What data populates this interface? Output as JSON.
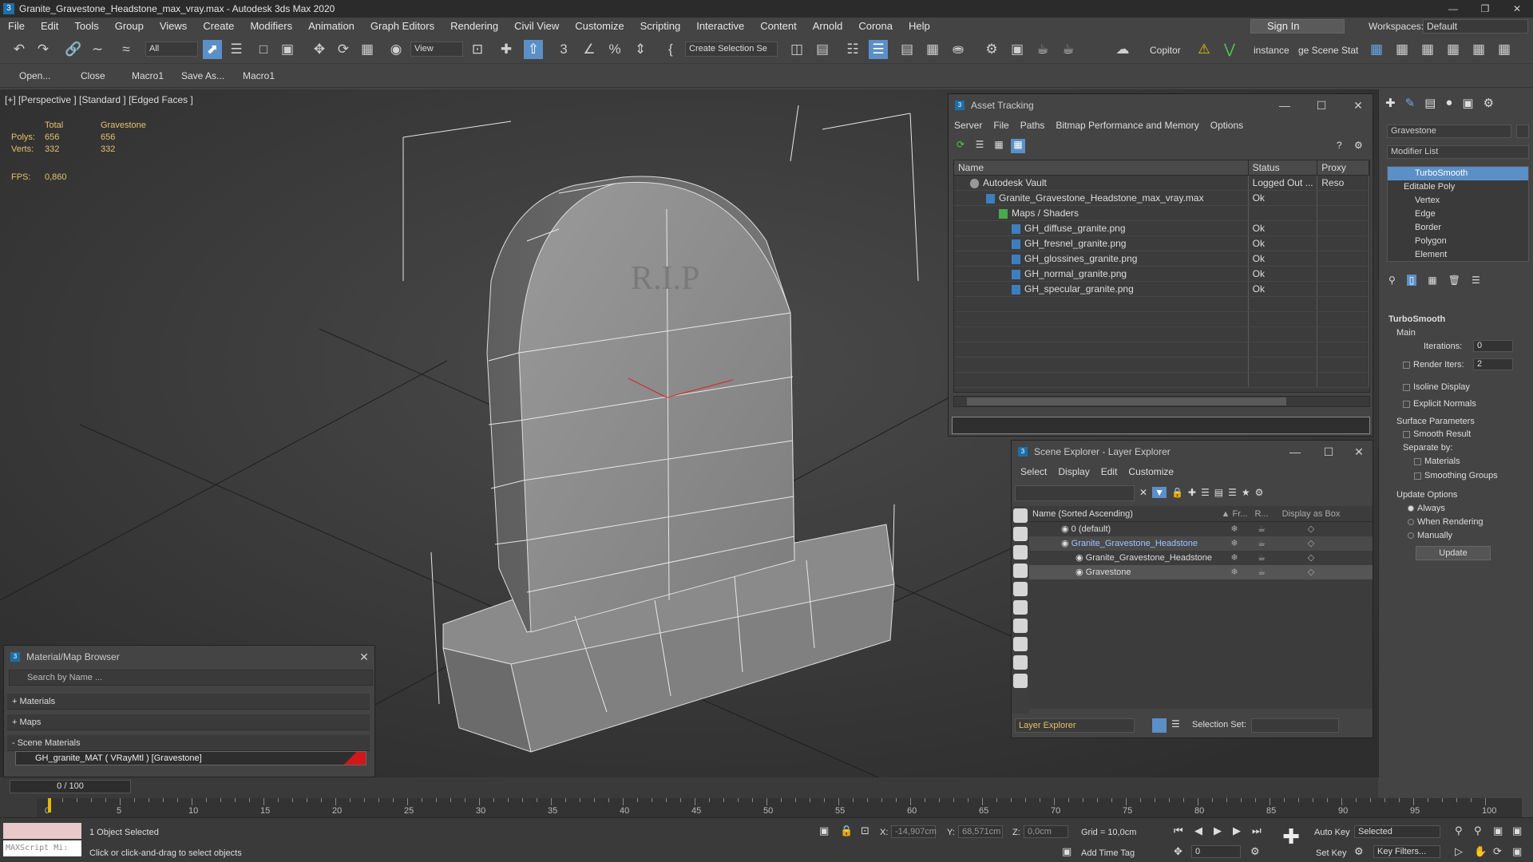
{
  "window": {
    "title": "Granite_Gravestone_Headstone_max_vray.max - Autodesk 3ds Max 2020",
    "app_icon": "3"
  },
  "menu": [
    "File",
    "Edit",
    "Tools",
    "Group",
    "Views",
    "Create",
    "Modifiers",
    "Animation",
    "Graph Editors",
    "Rendering",
    "Civil View",
    "Customize",
    "Scripting",
    "Interactive",
    "Content",
    "Arnold",
    "Corona",
    "Help"
  ],
  "account": {
    "sign_in": "Sign In",
    "workspaces_label": "Workspaces:",
    "workspace": "Default"
  },
  "toolbar": {
    "filter": "All",
    "view": "View",
    "selection_set": "Create Selection Se",
    "copitor": "Copitor",
    "instance": "instance",
    "scene_state": "ge Scene Stat"
  },
  "macrobar": [
    "Open...",
    "Close",
    "Macro1",
    "Save As...",
    "Macro1"
  ],
  "viewport": {
    "label": "[+] [Perspective ] [Standard ] [Edged Faces ]",
    "stats": {
      "h1": "Total",
      "h2": "Gravestone",
      "polys_label": "Polys:",
      "polys_total": "656",
      "polys_obj": "656",
      "verts_label": "Verts:",
      "verts_total": "332",
      "verts_obj": "332",
      "fps_label": "FPS:",
      "fps": "0,860"
    },
    "engraving": "R.I.P"
  },
  "asset_tracking": {
    "title": "Asset Tracking",
    "menu": [
      "Server",
      "File",
      "Paths",
      "Bitmap Performance and Memory",
      "Options"
    ],
    "columns": [
      "Name",
      "Status",
      "Proxy Reso"
    ],
    "rows": [
      {
        "name": "Autodesk Vault",
        "status": "Logged Out ...",
        "indent": 20,
        "icon": "grey"
      },
      {
        "name": "Granite_Gravestone_Headstone_max_vray.max",
        "status": "Ok",
        "indent": 40,
        "icon": "blue"
      },
      {
        "name": "Maps / Shaders",
        "status": "",
        "indent": 56,
        "icon": "green"
      },
      {
        "name": "GH_diffuse_granite.png",
        "status": "Ok",
        "indent": 72,
        "icon": "blue"
      },
      {
        "name": "GH_fresnel_granite.png",
        "status": "Ok",
        "indent": 72,
        "icon": "blue"
      },
      {
        "name": "GH_glossines_granite.png",
        "status": "Ok",
        "indent": 72,
        "icon": "blue"
      },
      {
        "name": "GH_normal_granite.png",
        "status": "Ok",
        "indent": 72,
        "icon": "blue"
      },
      {
        "name": "GH_specular_granite.png",
        "status": "Ok",
        "indent": 72,
        "icon": "blue"
      }
    ]
  },
  "scene_explorer": {
    "title": "Scene Explorer - Layer Explorer",
    "menu": [
      "Select",
      "Display",
      "Edit",
      "Customize"
    ],
    "columns": [
      "Name (Sorted Ascending)",
      "▲ Fr...",
      "R...",
      "Display as Box"
    ],
    "rows": [
      {
        "name": "0 (default)",
        "indent": 40
      },
      {
        "name": "Granite_Gravestone_Headstone",
        "indent": 40
      },
      {
        "name": "Granite_Gravestone_Headstone",
        "indent": 58
      },
      {
        "name": "Gravestone",
        "indent": 58
      }
    ],
    "explorer_type": "Layer Explorer",
    "selection_set_label": "Selection Set:"
  },
  "material_browser": {
    "title": "Material/Map Browser",
    "search_placeholder": "Search by Name ...",
    "sections": [
      "+ Materials",
      "+ Maps",
      "- Scene Materials"
    ],
    "material": "GH_granite_MAT  ( VRayMtl )  [Gravestone]"
  },
  "command_panel": {
    "object_name": "Gravestone",
    "modifier_list": "Modifier List",
    "stack": [
      "TurboSmooth",
      "Editable Poly",
      "Vertex",
      "Edge",
      "Border",
      "Polygon",
      "Element"
    ],
    "rollout": "TurboSmooth",
    "main": "Main",
    "iterations_label": "Iterations:",
    "iterations": "0",
    "render_iters_label": "Render Iters:",
    "render_iters": "2",
    "isoline": "Isoline Display",
    "explicit": "Explicit Normals",
    "surface": "Surface Parameters",
    "smooth_result": "Smooth Result",
    "separate_by": "Separate by:",
    "materials": "Materials",
    "smoothing_groups": "Smoothing Groups",
    "update_options": "Update Options",
    "always": "Always",
    "when_rendering": "When Rendering",
    "manually": "Manually",
    "update": "Update"
  },
  "timeline": {
    "frame": "0 / 100",
    "ticks": [
      "0",
      "5",
      "10",
      "15",
      "20",
      "25",
      "30",
      "35",
      "40",
      "45",
      "50",
      "55",
      "60",
      "65",
      "70",
      "75",
      "80",
      "85",
      "90",
      "95",
      "100"
    ]
  },
  "status": {
    "maxscript": "MAXScript Mi:",
    "selected": "1 Object Selected",
    "prompt": "Click or click-and-drag to select objects",
    "x_label": "X:",
    "x": "-14,907cm",
    "y_label": "Y:",
    "y": "68,571cm",
    "z_label": "Z:",
    "z": "0,0cm",
    "grid": "Grid = 10,0cm",
    "add_time_tag": "Add Time Tag",
    "auto_key": "Auto Key",
    "set_key": "Set Key",
    "selected_mode": "Selected",
    "key_filters": "Key Filters...",
    "frame_field": "0"
  }
}
